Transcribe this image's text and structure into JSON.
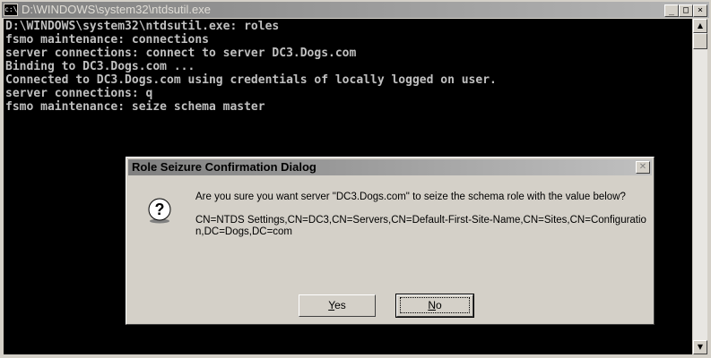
{
  "window": {
    "title": "D:\\WINDOWS\\system32\\ntdsutil.exe",
    "icon": "console-icon",
    "minimize_glyph": "_",
    "maximize_glyph": "□",
    "close_glyph": "×"
  },
  "console": {
    "lines": [
      "D:\\WINDOWS\\system32\\ntdsutil.exe: roles",
      "fsmo maintenance: connections",
      "server connections: connect to server DC3.Dogs.com",
      "Binding to DC3.Dogs.com ...",
      "Connected to DC3.Dogs.com using credentials of locally logged on user.",
      "server connections: q",
      "fsmo maintenance: seize schema master"
    ]
  },
  "dialog": {
    "title": "Role Seizure Confirmation Dialog",
    "icon": "question-icon",
    "message": "Are you sure you want server \"DC3.Dogs.com\" to seize the schema role with the value below?",
    "detail": "CN=NTDS Settings,CN=DC3,CN=Servers,CN=Default-First-Site-Name,CN=Sites,CN=Configuration,DC=Dogs,DC=com",
    "yes_accel": "Y",
    "yes_rest": "es",
    "no_accel": "N",
    "no_rest": "o"
  }
}
